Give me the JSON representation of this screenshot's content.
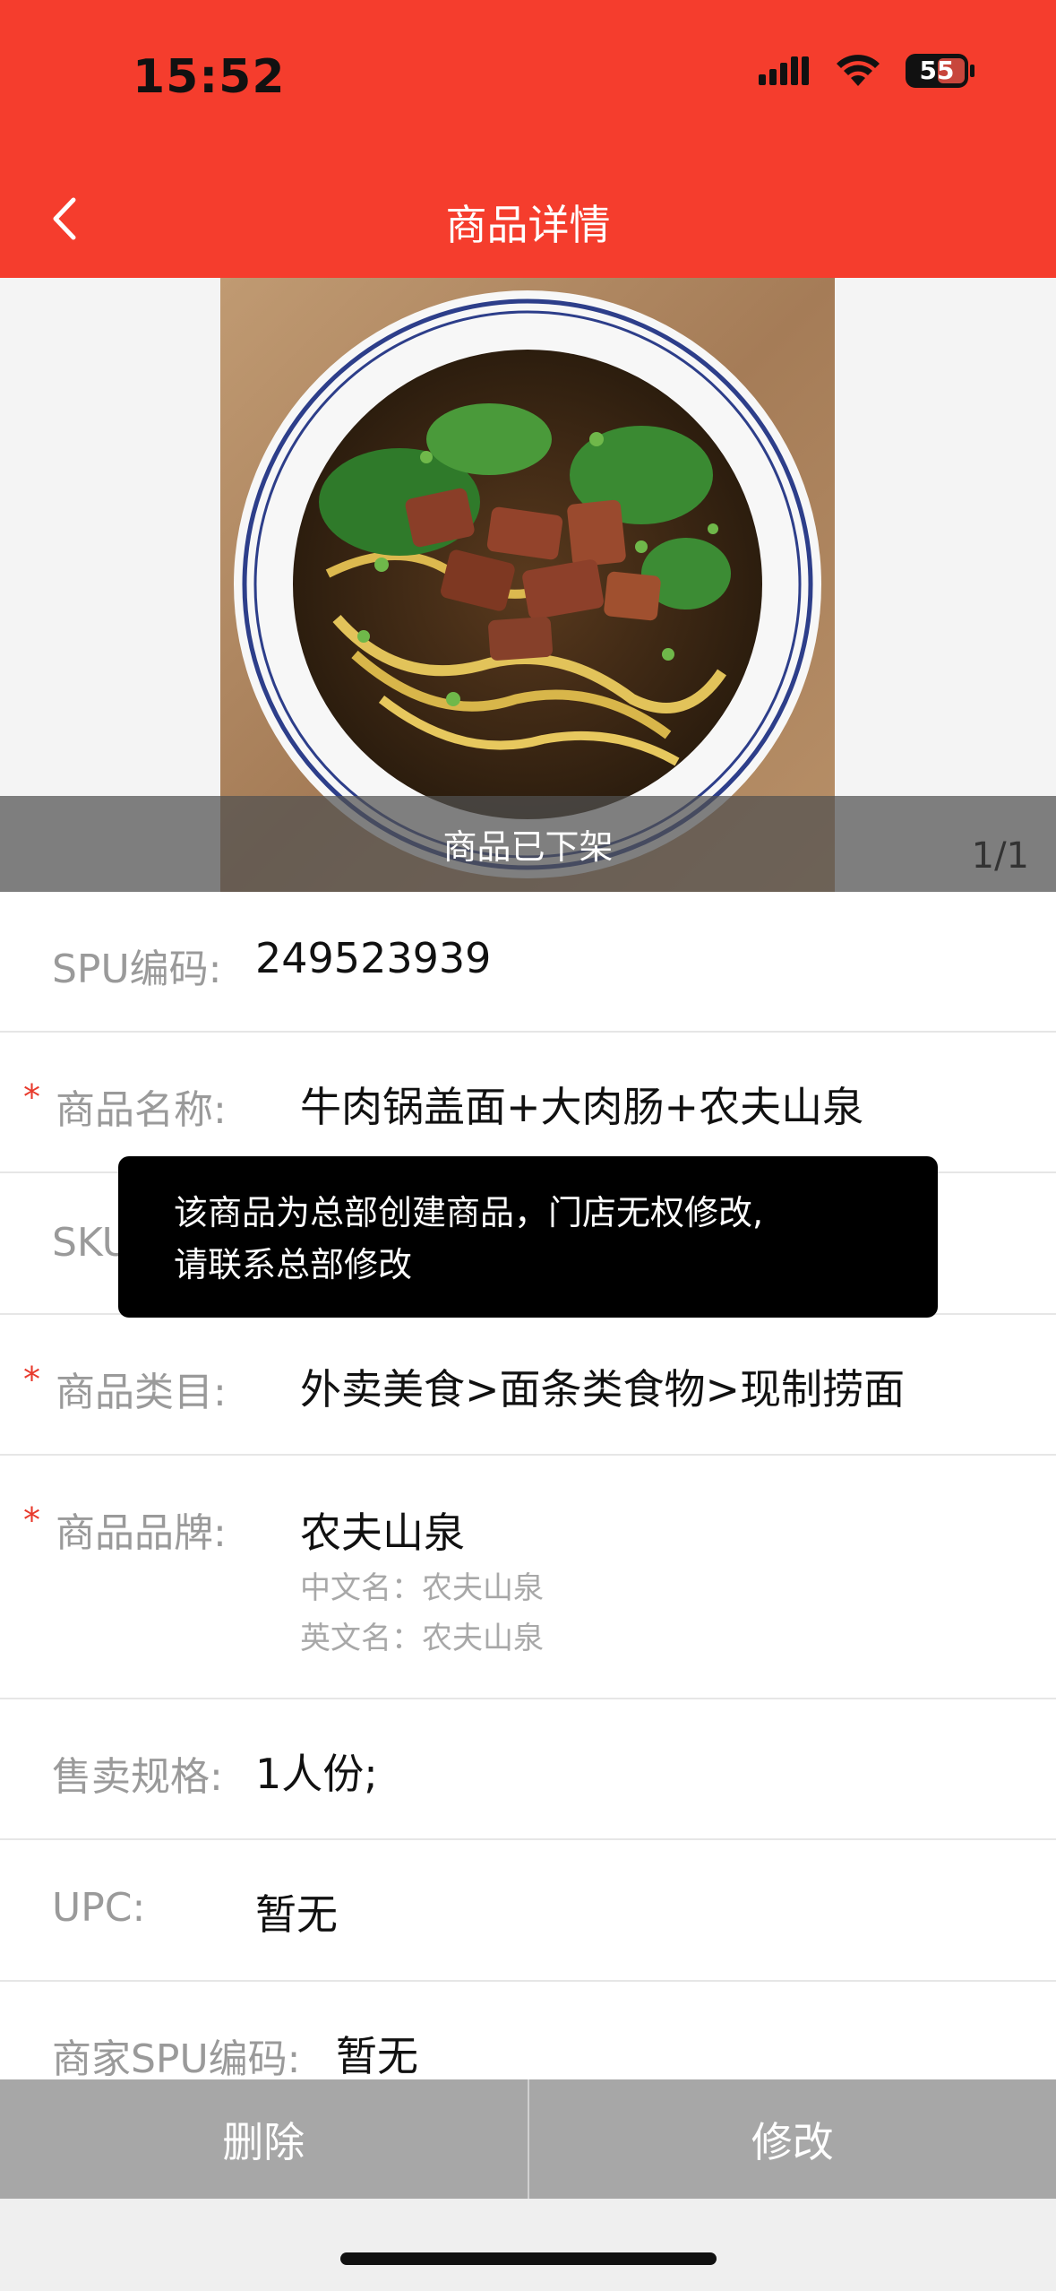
{
  "status_bar": {
    "time": "15:52",
    "battery": "55"
  },
  "nav": {
    "title": "商品详情"
  },
  "gallery": {
    "offline_label": "商品已下架",
    "page_indicator": "1/1"
  },
  "fields": {
    "spu_code": {
      "label": "SPU编码:",
      "value": "249523939"
    },
    "name": {
      "label": "商品名称:",
      "value": "牛肉锅盖面+大肉肠+农夫山泉"
    },
    "sku": {
      "label": "SKU"
    },
    "category": {
      "label": "商品类目:",
      "value": "外卖美食>面条类食物>现制捞面"
    },
    "brand": {
      "label": "商品品牌:",
      "value": "农夫山泉",
      "cn_name": "中文名：农夫山泉",
      "en_name": "英文名：农夫山泉"
    },
    "spec": {
      "label": "售卖规格:",
      "value": "1人份;"
    },
    "upc": {
      "label": "UPC:",
      "value": "暂无"
    },
    "merchant_spu": {
      "label": "商家SPU编码:",
      "value": "暂无"
    }
  },
  "required_mark": "*",
  "toast": {
    "line1": "该商品为总部创建商品，门店无权修改,",
    "line2": "请联系总部修改"
  },
  "actions": {
    "delete": "删除",
    "edit": "修改"
  },
  "colors": {
    "brand_red": "#f53d2d",
    "required_red": "#e83a2c",
    "bottom_bar": "#a7a7a7"
  }
}
